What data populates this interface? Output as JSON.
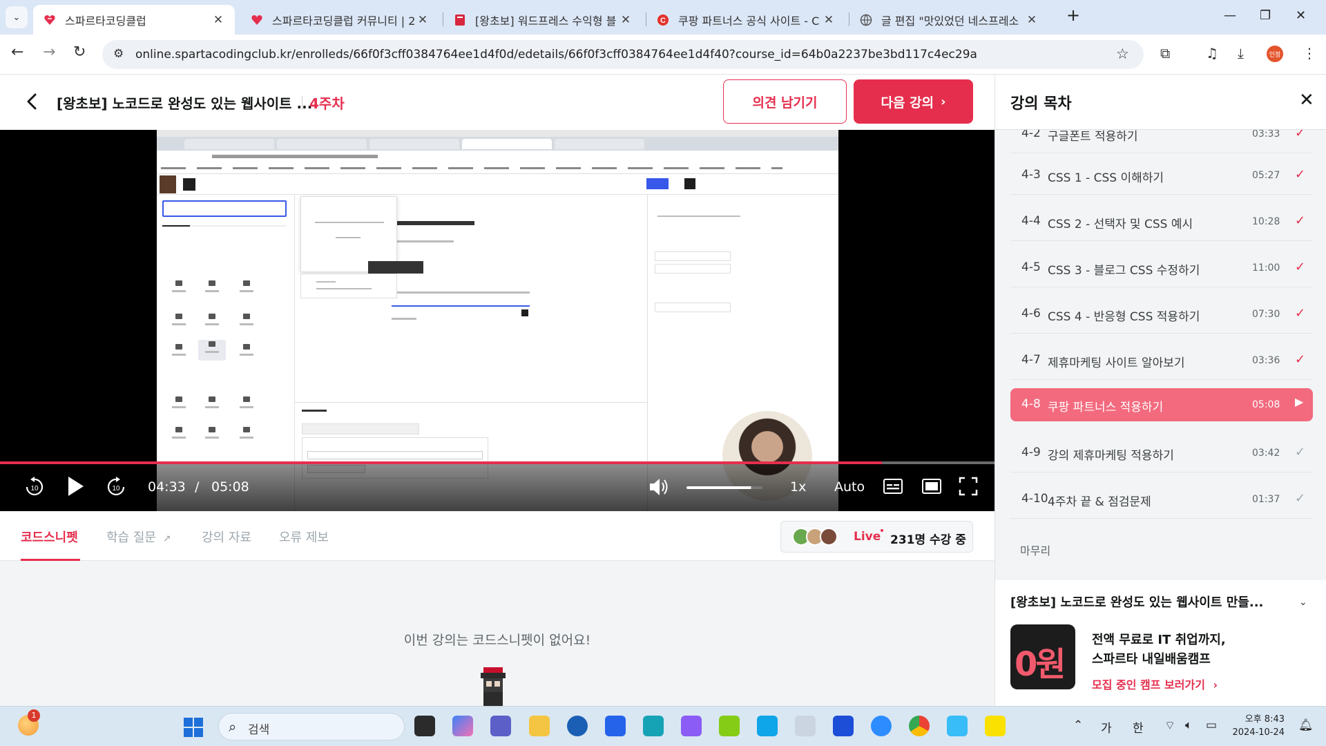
{
  "browser": {
    "tabs": [
      {
        "title": "스파르타코딩클럽",
        "active": true
      },
      {
        "title": "스파르타코딩클럽 커뮤니티 | 2",
        "active": false
      },
      {
        "title": "[왕초보] 워드프레스 수익형 블",
        "active": false
      },
      {
        "title": "쿠팡 파트너스 공식 사이트 - C",
        "active": false
      },
      {
        "title": "글 편집 \"맛있었던 네스프레소",
        "active": false
      }
    ],
    "url": "online.spartacodingclub.kr/enrolleds/66f0f3cff0384764ee1d4f0d/edetails/66f0f3cff0384764ee1d4f40?course_id=64b0a2237be3bd117c4ec29a",
    "profile_label": "인정"
  },
  "header": {
    "course_title": "[왕초보] 노코드로 완성도 있는 웹사이트 ...",
    "week": "4주차",
    "feedback_button": "의견 남기기",
    "next_button": "다음 강의"
  },
  "player": {
    "current_time": "04:33",
    "separator": "/",
    "duration": "05:08",
    "progress": 0.887,
    "speed": "1x",
    "quality": "Auto",
    "volume": 0.85
  },
  "lecture_tabs": [
    {
      "label": "코드스니펫",
      "active": true
    },
    {
      "label": "학습 질문",
      "active": false
    },
    {
      "label": "강의 자료",
      "active": false
    },
    {
      "label": "오류 제보",
      "active": false
    }
  ],
  "live": {
    "label": "Live",
    "count_text": "231명 수강 중"
  },
  "snippet": {
    "empty_message": "이번 강의는 코드스니펫이 없어요!"
  },
  "sidebar": {
    "title": "강의 목차",
    "partial_item": {
      "num": "4-2",
      "name": "구글폰트 적용하기",
      "duration": "03:33"
    },
    "items": [
      {
        "num": "4-3",
        "name": "CSS 1 - CSS 이해하기",
        "duration": "05:27",
        "status": "done"
      },
      {
        "num": "4-4",
        "name": "CSS 2 - 선택자 및 CSS 예시",
        "duration": "10:28",
        "status": "done"
      },
      {
        "num": "4-5",
        "name": "CSS 3 - 블로그 CSS 수정하기",
        "duration": "11:00",
        "status": "done"
      },
      {
        "num": "4-6",
        "name": "CSS 4 - 반응형 CSS 적용하기",
        "duration": "07:30",
        "status": "done"
      },
      {
        "num": "4-7",
        "name": "제휴마케팅 사이트 알아보기",
        "duration": "03:36",
        "status": "done"
      },
      {
        "num": "4-8",
        "name": "쿠팡 파트너스 적용하기",
        "duration": "05:08",
        "status": "current"
      },
      {
        "num": "4-9",
        "name": "강의 제휴마케팅 적용하기",
        "duration": "03:42",
        "status": "todo"
      },
      {
        "num": "4-10",
        "name": "4주차 끝 & 점검문제",
        "duration": "01:37",
        "status": "todo"
      }
    ],
    "wrapup": "마무리",
    "course_title": "[왕초보] 노코드로 완성도 있는 웹사이트 만들...",
    "promo": {
      "image_text": "0원",
      "line1": "전액 무료로 IT 취업까지,",
      "line2": "스파르타 내일배움캠프",
      "link": "모집 중인 캠프 보러가기"
    }
  },
  "taskbar": {
    "search_placeholder": "검색",
    "ime_1": "가",
    "ime_2": "한",
    "time": "오후 8:43",
    "date": "2024-10-24",
    "weather_badge": "1"
  },
  "colors": {
    "brand": "#e52e4d",
    "current_item": "#f36a7e"
  }
}
